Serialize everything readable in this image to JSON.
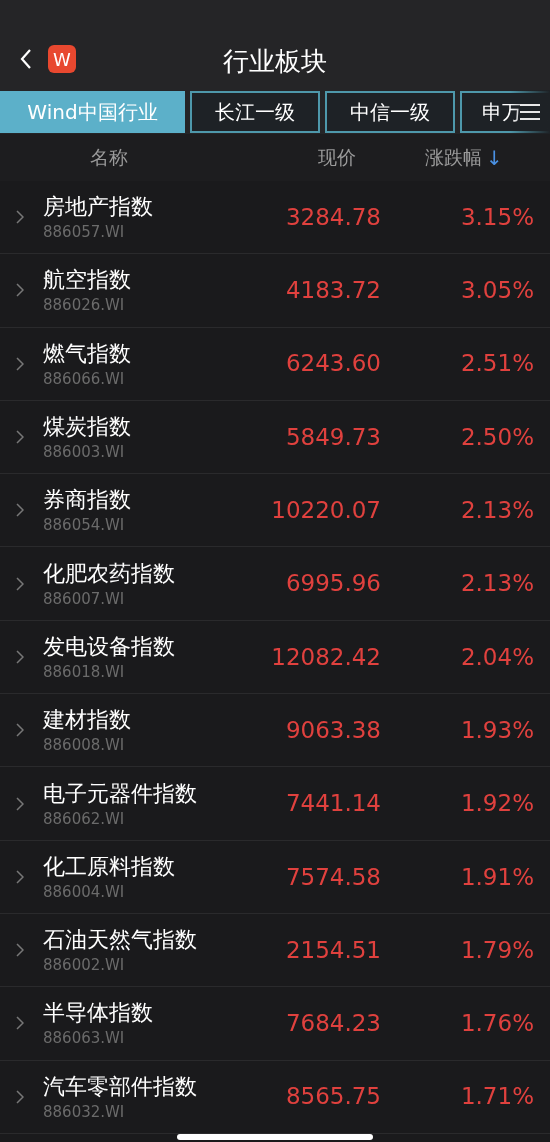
{
  "nav": {
    "title": "行业板块",
    "logo": "W"
  },
  "tabs": [
    {
      "label": "Wind中国行业",
      "selected": true
    },
    {
      "label": "长江一级",
      "selected": false
    },
    {
      "label": "中信一级",
      "selected": false
    },
    {
      "label": "申万",
      "selected": false
    }
  ],
  "table": {
    "columns": [
      "名称",
      "现价",
      "涨跌幅"
    ],
    "sort_icon": "↓",
    "rows": [
      {
        "name": "房地产指数",
        "code": "886057.WI",
        "price": "3284.78",
        "change": "3.15%"
      },
      {
        "name": "航空指数",
        "code": "886026.WI",
        "price": "4183.72",
        "change": "3.05%"
      },
      {
        "name": "燃气指数",
        "code": "886066.WI",
        "price": "6243.60",
        "change": "2.51%"
      },
      {
        "name": "煤炭指数",
        "code": "886003.WI",
        "price": "5849.73",
        "change": "2.50%"
      },
      {
        "name": "券商指数",
        "code": "886054.WI",
        "price": "10220.07",
        "change": "2.13%"
      },
      {
        "name": "化肥农药指数",
        "code": "886007.WI",
        "price": "6995.96",
        "change": "2.13%"
      },
      {
        "name": "发电设备指数",
        "code": "886018.WI",
        "price": "12082.42",
        "change": "2.04%"
      },
      {
        "name": "建材指数",
        "code": "886008.WI",
        "price": "9063.38",
        "change": "1.93%"
      },
      {
        "name": "电子元器件指数",
        "code": "886062.WI",
        "price": "7441.14",
        "change": "1.92%"
      },
      {
        "name": "化工原料指数",
        "code": "886004.WI",
        "price": "7574.58",
        "change": "1.91%"
      },
      {
        "name": "石油天然气指数",
        "code": "886002.WI",
        "price": "2154.51",
        "change": "1.79%"
      },
      {
        "name": "半导体指数",
        "code": "886063.WI",
        "price": "7684.23",
        "change": "1.76%"
      },
      {
        "name": "汽车零部件指数",
        "code": "886032.WI",
        "price": "8565.75",
        "change": "1.71%"
      }
    ]
  }
}
